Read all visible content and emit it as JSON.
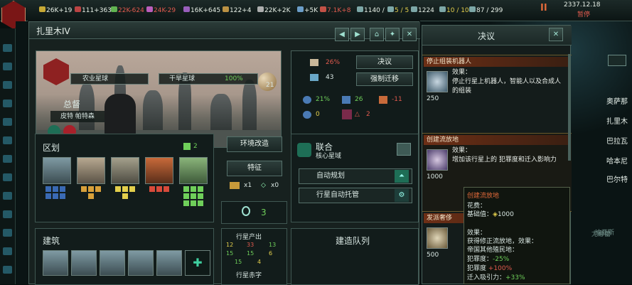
{
  "topbar": {
    "resources": [
      {
        "value": "26K+19",
        "color": "#e6efe6",
        "icon": "energy-icon",
        "ic": "#e8c23a"
      },
      {
        "value": "111+363",
        "color": "#e6efe6",
        "icon": "minerals-icon",
        "ic": "#d84a4a"
      },
      {
        "value": "22K-624",
        "color": "#e05a4e",
        "icon": "food-icon",
        "ic": "#6fcf5a"
      },
      {
        "value": "24K-29",
        "color": "#e05a4e",
        "icon": "consumer-goods-icon",
        "ic": "#d86ad8"
      },
      {
        "value": "16K+645",
        "color": "#e6efe6",
        "icon": "alloys-icon",
        "ic": "#b06ad8"
      },
      {
        "value": "122+4",
        "color": "#e6efe6",
        "icon": "influence-icon",
        "ic": "#d8a64a"
      },
      {
        "value": "22K+2K",
        "color": "#e6efe6",
        "icon": "unity-icon",
        "ic": "#c8c8c8"
      },
      {
        "value": "+5K",
        "color": "#e6efe6",
        "icon": "research-icon",
        "ic": "#7ab4e6"
      },
      {
        "value": "7.1K+8",
        "color": "#e05a4e",
        "icon": "strategic-icon",
        "ic": "#e05a4e"
      },
      {
        "value": "1140 / ",
        "color": "#e6efe6",
        "icon": "pop-icon",
        "ic": "#8fbfbf"
      },
      {
        "value": "5 / 5",
        "color": "#e3cf4c",
        "icon": "envoy-icon",
        "ic": "#8fbfbf"
      },
      {
        "value": "1224",
        "color": "#e6efe6",
        "icon": "naval-icon",
        "ic": "#8fbfbf"
      },
      {
        "value": "10 / 10",
        "color": "#e3cf4c",
        "icon": "fleet-icon",
        "ic": "#8fbfbf"
      },
      {
        "value": "87 / 299",
        "color": "#e6efe6",
        "icon": "capacity-icon",
        "ic": "#8fbfbf"
      }
    ],
    "date": "2337.12.18",
    "paused": "暂停"
  },
  "planet": {
    "name": "扎里木IV",
    "designation": "农业星球",
    "planet_class": "干旱星球",
    "habitability": "100%",
    "size": "21",
    "governor_title": "总督",
    "governor_name": "皮特 帕特森",
    "stability": "26%",
    "amenities": "43",
    "crime": "21%",
    "jobs": "26",
    "housing": "-11",
    "free_housing": "0",
    "unemployed": "2",
    "decision_btn": "决议",
    "resettle_btn": "强制迁移"
  },
  "districts": {
    "title": "区划",
    "slots": "2"
  },
  "terraform_btn": "环境改造",
  "traits_btn": "特征",
  "traits": {
    "a": "x1",
    "b": "x0"
  },
  "deposits": "3",
  "sector": {
    "title": "联合",
    "subtitle": "核心星域"
  },
  "auto_build": "自动规划",
  "auto_manage": "行星自动托管",
  "buildings": {
    "title": "建筑"
  },
  "queue": {
    "title": "建造队列"
  },
  "output": {
    "title": "行星产出",
    "row1": [
      "12",
      "33",
      "13"
    ],
    "row2": [
      "15",
      "15",
      "6"
    ],
    "row3": [
      "15",
      "4"
    ],
    "deficit": "行星赤字"
  },
  "decisions": {
    "title": "决议",
    "items": [
      {
        "title": "停止组装机器人",
        "effect_label": "效果：",
        "effect": "停止行星上机器人，智能人以及合成人的组装",
        "cost": "250"
      },
      {
        "title": "创建流放地",
        "effect_label": "效果：",
        "effect": "增加该行星上的 犯罪度和迁入影响力",
        "cost": "1000"
      },
      {
        "title": "发派奢侈",
        "cost": "500"
      }
    ]
  },
  "tooltip": {
    "title": "创建流放地",
    "cost_label": "花费：",
    "base_label": "基础值：",
    "base_value": "1000",
    "effect_label": "效果：",
    "gain": "获得修正流放地，效果：",
    "other": "帝国其他殖民地：",
    "crime": "犯罪度：",
    "crime_val": "-25%",
    "crime2": "犯罪度",
    "crime2_val": "+100%",
    "migration": "迁入吸引力：",
    "migration_val": "+33%"
  },
  "sidebar_right": [
    "奥萨那",
    "扎里木",
    "巴拉瓦",
    "哈本尼",
    "巴尔特"
  ],
  "background_labels": [
    "迪亚斯",
    "尤娜蕾"
  ]
}
